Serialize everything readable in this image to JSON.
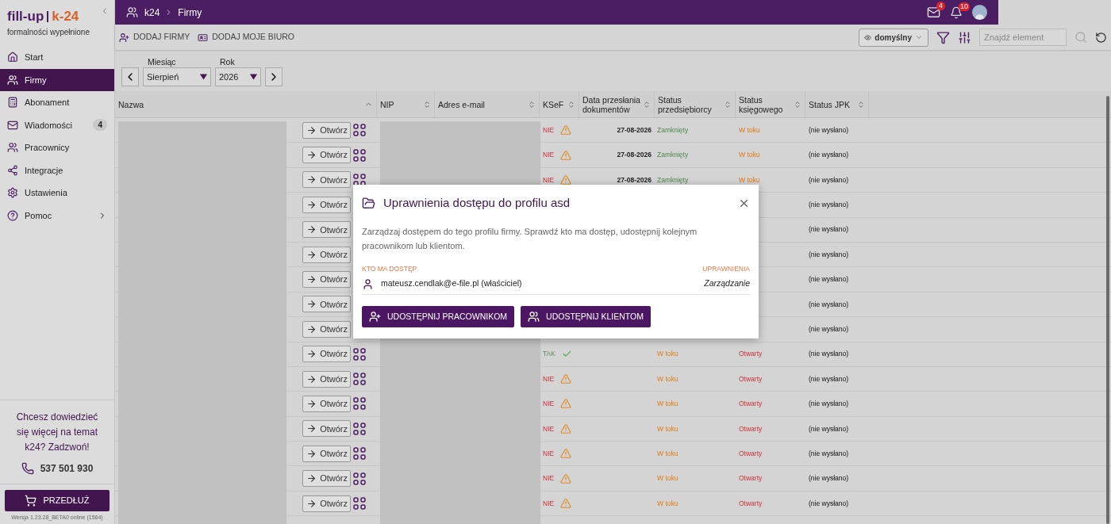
{
  "sidebar": {
    "logo": {
      "brand_left": "fill-up",
      "brand_right": "k-24",
      "tagline": "formalności wypełnione"
    },
    "items": [
      {
        "label": "Start",
        "selected": false
      },
      {
        "label": "Firmy",
        "selected": true
      },
      {
        "label": "Abonament",
        "selected": false
      },
      {
        "label": "Wiadomości",
        "selected": false,
        "badge": "4"
      },
      {
        "label": "Pracownicy",
        "selected": false
      },
      {
        "label": "Integracje",
        "selected": false
      },
      {
        "label": "Ustawienia",
        "selected": false
      },
      {
        "label": "Pomoc",
        "selected": false,
        "submenu": true
      }
    ],
    "promo": {
      "text": "Chcesz dowiedzieć się więcej na temat k24? Zadzwoń!",
      "phone": "537 501 930"
    },
    "renew_button": "PRZEDŁUŻ",
    "version": "Wersja 1.23.28_BETA0 online (1564)"
  },
  "topbar": {
    "breadcrumb": [
      "k24",
      "Firmy"
    ],
    "mail_badge": "4",
    "bell_badge": "10"
  },
  "toolbar": {
    "actions": [
      {
        "label": "DODAJ FIRMY"
      },
      {
        "label": "DODAJ MOJE BIURO"
      }
    ],
    "view": "domyślny",
    "search": {
      "placeholder": "Znajdź element"
    }
  },
  "filters": {
    "month": {
      "label": "Miesiąc",
      "value": "Sierpień"
    },
    "year": {
      "label": "Rok",
      "value": "2026"
    }
  },
  "table": {
    "columns": [
      "Nazwa",
      "NIP",
      "Adres e-mail",
      "KSeF",
      "Data przesłania dokumentów",
      "Status przedsiębiorcy",
      "Status księgowego",
      "Status JPK"
    ],
    "rows": [
      {
        "open": "Otwórz",
        "ksef": "NIE",
        "ksef_ok": false,
        "date": "27-08-2026",
        "status_p": "Zamknięty",
        "status_k": "W toku",
        "jpk": "(nie wysłano)"
      },
      {
        "open": "Otwórz",
        "ksef": "NIE",
        "ksef_ok": false,
        "date": "27-08-2026",
        "status_p": "Zamknięty",
        "status_k": "W toku",
        "jpk": "(nie wysłano)"
      },
      {
        "open": "Otwórz",
        "ksef": "NIE",
        "ksef_ok": false,
        "date": "27-08-2026",
        "status_p": "Zamknięty",
        "status_k": "W toku",
        "jpk": "(nie wysłano)"
      },
      {
        "open": "Otwórz",
        "jpk": "(nie wysłano)"
      },
      {
        "open": "Otwórz",
        "jpk": "(nie wysłano)"
      },
      {
        "open": "Otwórz",
        "jpk": "(nie wysłano)"
      },
      {
        "open": "Otwórz",
        "jpk": "(nie wysłano)"
      },
      {
        "open": "Otwórz",
        "jpk": "(nie wysłano)"
      },
      {
        "open": "Otwórz",
        "jpk": "(nie wysłano)"
      },
      {
        "open": "Otwórz",
        "ksef": "TAK",
        "ksef_ok": true,
        "status_p": "W toku",
        "status_k": "Otwarty",
        "jpk": "(nie wysłano)"
      },
      {
        "open": "Otwórz",
        "ksef": "NIE",
        "ksef_ok": false,
        "status_p": "W toku",
        "status_k": "Otwarty",
        "jpk": "(nie wysłano)"
      },
      {
        "open": "Otwórz",
        "ksef": "NIE",
        "ksef_ok": false,
        "status_p": "W toku",
        "status_k": "Otwarty",
        "jpk": "(nie wysłano)"
      },
      {
        "open": "Otwórz",
        "ksef": "NIE",
        "ksef_ok": false,
        "status_p": "W toku",
        "status_k": "Otwarty",
        "jpk": "(nie wysłano)"
      },
      {
        "open": "Otwórz",
        "ksef": "NIE",
        "ksef_ok": false,
        "status_p": "W toku",
        "status_k": "Otwarty",
        "jpk": "(nie wysłano)"
      },
      {
        "open": "Otwórz",
        "ksef": "NIE",
        "ksef_ok": false,
        "status_p": "W toku",
        "status_k": "Otwarty",
        "jpk": "(nie wysłano)"
      },
      {
        "open": "Otwórz",
        "ksef": "NIE",
        "ksef_ok": false,
        "status_p": "W toku",
        "status_k": "Otwarty",
        "jpk": "(nie wysłano)"
      }
    ]
  },
  "dialog": {
    "title": "Uprawnienia dostępu do profilu asd",
    "description": "Zarządzaj dostępem do tego profilu firmy. Sprawdź kto ma dostęp, udostępnij kolejnym pracownikom lub klientom.",
    "who_header": "KTO MA DOSTĘP",
    "rights_header": "UPRAWNIENIA",
    "entries": [
      {
        "user": "mateusz.cendlak@e-file.pl (właściciel)",
        "rights": "Zarządzanie"
      }
    ],
    "buttons": [
      "UDOSTĘPNIJ PRACOWNIKOM",
      "UDOSTĘPNIJ KLIENTOM"
    ]
  }
}
